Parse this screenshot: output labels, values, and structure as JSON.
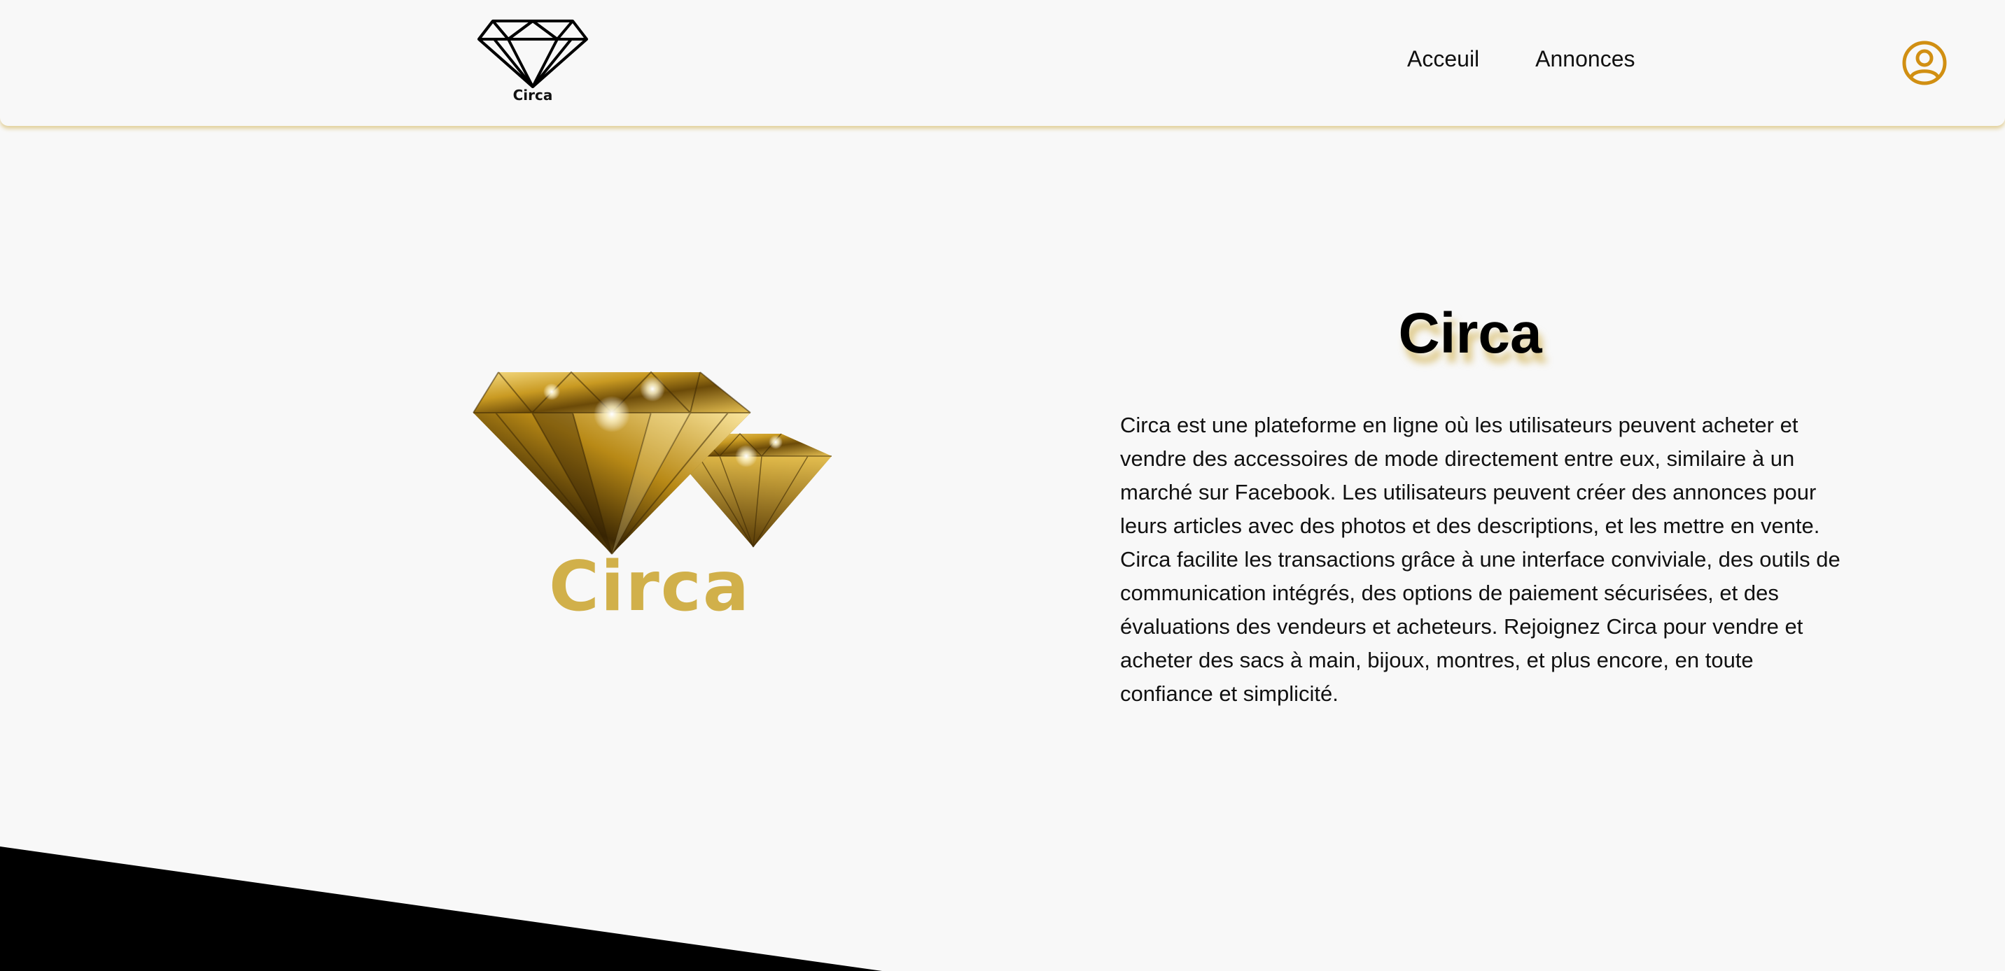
{
  "header": {
    "brand_name": "Circa",
    "nav": [
      {
        "label": "Acceuil"
      },
      {
        "label": "Annonces"
      }
    ],
    "user_icon": "user-circle-icon",
    "accent_color": "#d18f12"
  },
  "hero": {
    "logo_text": "Circa",
    "title": "Circa",
    "description": "Circa est une plateforme en ligne où les utilisateurs peuvent acheter et vendre des accessoires de mode directement entre eux, similaire à un marché sur Facebook. Les utilisateurs peuvent créer des annonces pour leurs articles avec des photos et des descriptions, et les mettre en vente. Circa facilite les transactions grâce à une interface conviviale, des outils de communication intégrés, des options de paiement sécurisées, et des évaluations des vendeurs et acheteurs. Rejoignez Circa pour vendre et acheter des sacs à main, bijoux, montres, et plus encore, en toute confiance et simplicité.",
    "gold_color": "#d1b04a"
  },
  "colors": {
    "background": "#f8f8f8",
    "text": "#111111",
    "shadow_gold": "#c8a028",
    "diagonal": "#000000"
  }
}
